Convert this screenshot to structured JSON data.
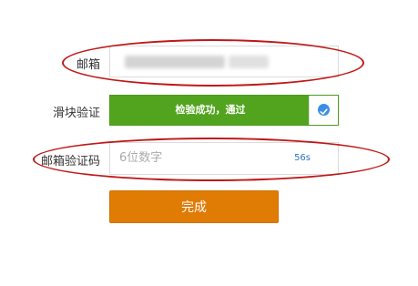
{
  "form": {
    "email_label": "邮箱",
    "slider_label": "滑块验证",
    "slider_text": "检验成功，通过",
    "code_label": "邮箱验证码",
    "code_placeholder": "6位数字",
    "countdown": "56s",
    "submit_label": "完成"
  },
  "icons": {
    "slider_check": "check-circle-icon"
  },
  "colors": {
    "slider_success": "#52a41f",
    "submit": "#e07b04",
    "countdown": "#2a73c5",
    "annotation": "#c01818",
    "check": "#3a8ee6"
  }
}
